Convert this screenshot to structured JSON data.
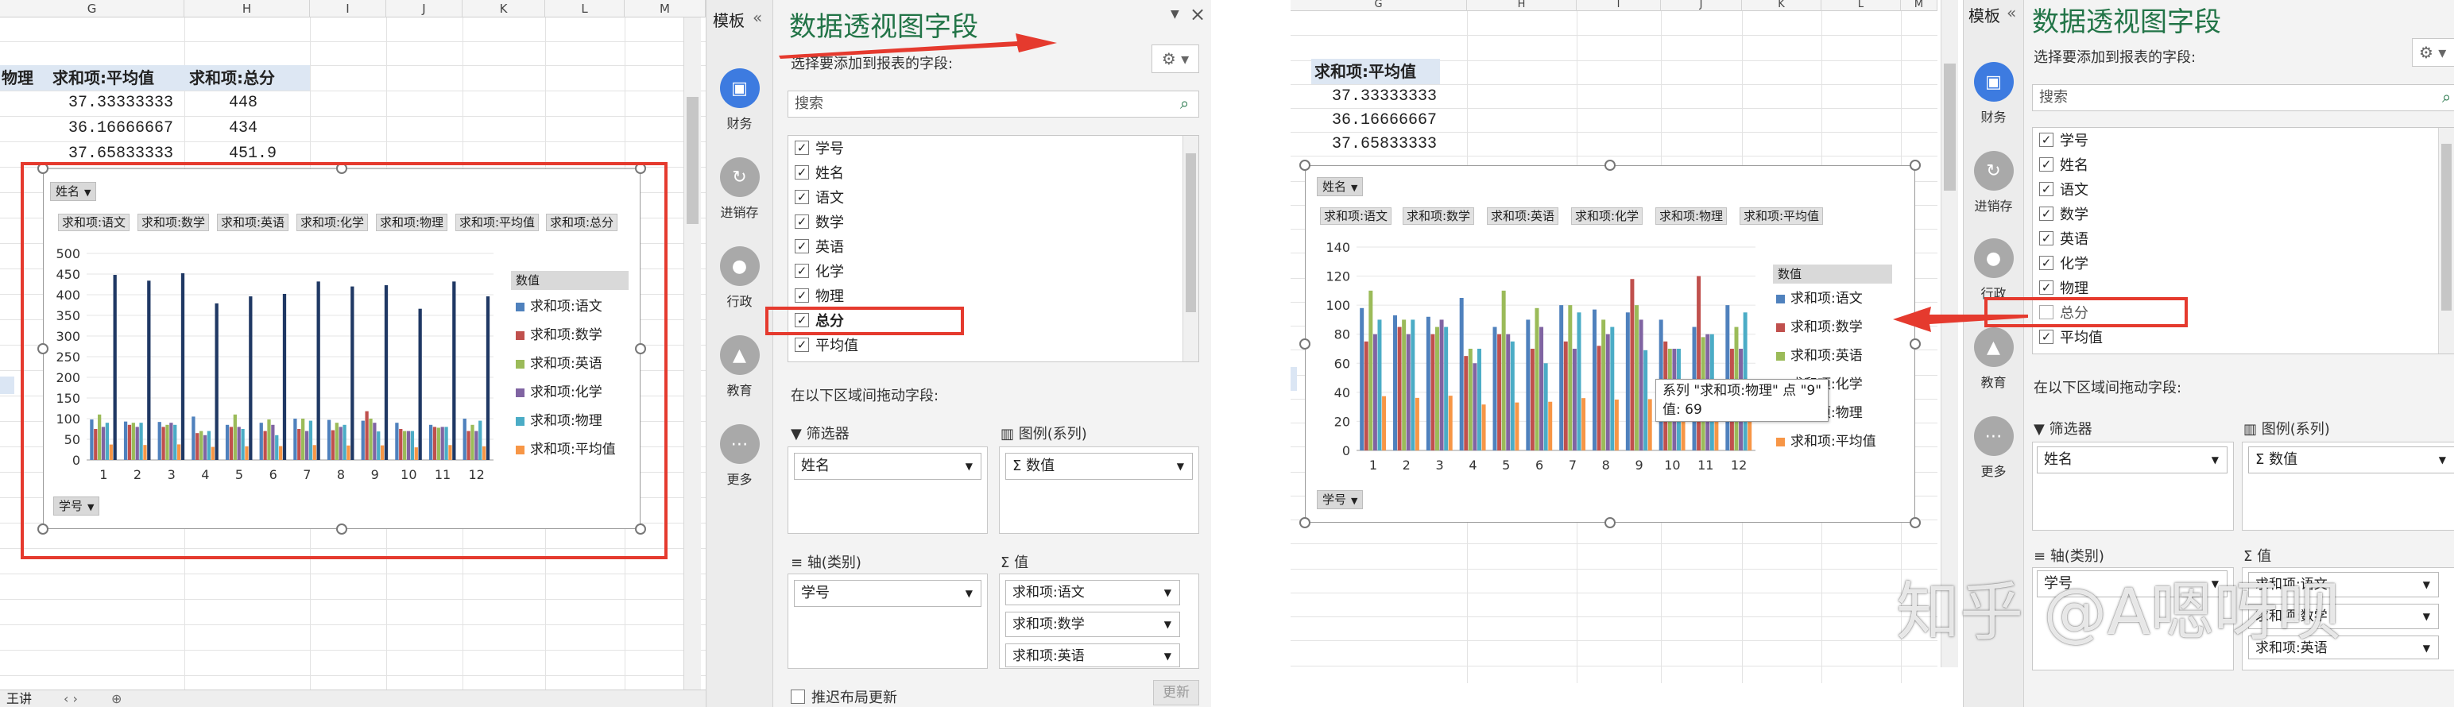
{
  "left": {
    "columns": [
      "G",
      "H",
      "I",
      "J",
      "K",
      "L",
      "M"
    ],
    "table": {
      "headers": [
        "物理",
        "求和项:平均值",
        "求和项:总分"
      ],
      "rows": [
        [
          "",
          "37.33333333",
          "448"
        ],
        [
          "",
          "36.16666667",
          "434"
        ],
        [
          "",
          "37.65833333",
          "451.9"
        ]
      ]
    },
    "chart": {
      "filter_button": "姓名",
      "axis_button": "学号",
      "value_buttons": [
        "求和项:语文",
        "求和项:数学",
        "求和项:英语",
        "求和项:化学",
        "求和项:物理",
        "求和项:平均值",
        "求和项:总分"
      ],
      "legend_title": "数值",
      "legend": [
        "求和项:语文",
        "求和项:数学",
        "求和项:英语",
        "求和项:化学",
        "求和项:物理",
        "求和项:平均值"
      ]
    },
    "ribbon": {
      "title": "模板",
      "items": [
        "财务",
        "进销存",
        "行政",
        "教育",
        "更多"
      ]
    },
    "pane": {
      "title": "数据透视图字段",
      "subtitle": "选择要添加到报表的字段:",
      "search_placeholder": "搜索",
      "fields": [
        {
          "label": "学号",
          "checked": true
        },
        {
          "label": "姓名",
          "checked": true
        },
        {
          "label": "语文",
          "checked": true
        },
        {
          "label": "数学",
          "checked": true
        },
        {
          "label": "英语",
          "checked": true
        },
        {
          "label": "化学",
          "checked": true
        },
        {
          "label": "物理",
          "checked": true
        },
        {
          "label": "总分",
          "checked": true
        },
        {
          "label": "平均值",
          "checked": true
        }
      ],
      "areas_label": "在以下区域间拖动字段:",
      "filter_label": "筛选器",
      "legend_label": "图例(系列)",
      "axis_label": "轴(类别)",
      "values_label": "值",
      "filter_value": "姓名",
      "legend_value": "Σ 数值",
      "axis_value": "学号",
      "values_list": [
        "求和项:语文",
        "求和项:数学",
        "求和项:英语"
      ],
      "defer_label": "推迟布局更新",
      "update_label": "更新"
    },
    "sheet_tab": "王讲"
  },
  "right": {
    "columns": [
      "G",
      "H",
      "I",
      "J",
      "K",
      "L",
      "M"
    ],
    "table": {
      "headers": [
        "求和项:平均值"
      ],
      "rows": [
        [
          "37.33333333"
        ],
        [
          "36.16666667"
        ],
        [
          "37.65833333"
        ]
      ]
    },
    "chart": {
      "filter_button": "姓名",
      "axis_button": "学号",
      "value_buttons": [
        "求和项:语文",
        "求和项:数学",
        "求和项:英语",
        "求和项:化学",
        "求和项:物理",
        "求和项:平均值"
      ],
      "legend_title": "数值",
      "legend": [
        "求和项:语文",
        "求和项:数学",
        "求和项:英语",
        "求和项:化学",
        "求和项:物理",
        "求和项:平均值"
      ],
      "tooltip_line1": "系列 \"求和项:物理\" 点 \"9\"",
      "tooltip_line2": "值: 69"
    },
    "ribbon": {
      "title": "模板",
      "items": [
        "财务",
        "进销存",
        "行政",
        "教育",
        "更多"
      ]
    },
    "pane": {
      "title": "数据透视图字段",
      "subtitle": "选择要添加到报表的字段:",
      "search_placeholder": "搜索",
      "fields": [
        {
          "label": "学号",
          "checked": true
        },
        {
          "label": "姓名",
          "checked": true
        },
        {
          "label": "语文",
          "checked": true
        },
        {
          "label": "数学",
          "checked": true
        },
        {
          "label": "英语",
          "checked": true
        },
        {
          "label": "化学",
          "checked": true
        },
        {
          "label": "物理",
          "checked": true
        },
        {
          "label": "总分",
          "checked": false
        },
        {
          "label": "平均值",
          "checked": true
        }
      ],
      "areas_label": "在以下区域间拖动字段:",
      "filter_label": "筛选器",
      "legend_label": "图例(系列)",
      "axis_label": "轴(类别)",
      "values_label": "值",
      "filter_value": "姓名",
      "legend_value": "Σ 数值",
      "axis_value": "学号",
      "values_list": [
        "求和项:语文",
        "求和项:数学",
        "求和项:英语"
      ]
    },
    "watermark": "知乎 @A嗯呀呗"
  },
  "colors": {
    "语文": "#4f81bd",
    "数学": "#c0504d",
    "英语": "#9bbb59",
    "化学": "#8064a2",
    "物理": "#4bacc6",
    "平均值": "#f79646",
    "总分": "#1f3864",
    "accent": "#227447",
    "highlight": "#e53a2e"
  },
  "chart_data": [
    {
      "type": "bar",
      "categories": [
        "1",
        "2",
        "3",
        "4",
        "5",
        "6",
        "7",
        "8",
        "9",
        "10",
        "11",
        "12"
      ],
      "ylim": [
        0,
        500
      ],
      "yticks": [
        0,
        50,
        100,
        150,
        200,
        250,
        300,
        350,
        400,
        450,
        500
      ],
      "series": [
        {
          "name": "求和项:语文",
          "values": [
            98,
            93,
            92,
            105,
            85,
            90,
            100,
            97,
            95,
            90,
            85,
            100
          ]
        },
        {
          "name": "求和项:数学",
          "values": [
            75,
            85,
            80,
            65,
            80,
            70,
            75,
            72,
            118,
            75,
            80,
            70
          ]
        },
        {
          "name": "求和项:英语",
          "values": [
            110,
            90,
            85,
            70,
            110,
            98,
            100,
            90,
            100,
            70,
            78,
            85
          ]
        },
        {
          "name": "求和项:化学",
          "values": [
            80,
            80,
            90,
            60,
            80,
            85,
            70,
            80,
            90,
            70,
            80,
            70
          ]
        },
        {
          "name": "求和项:物理",
          "values": [
            90,
            90,
            85,
            70,
            75,
            60,
            95,
            85,
            69,
            70,
            80,
            95
          ]
        },
        {
          "name": "求和项:平均值",
          "values": [
            37.33,
            36.17,
            37.66,
            31.6,
            33.0,
            33.5,
            36.0,
            35.0,
            35.3,
            30.5,
            36.0,
            33.0
          ]
        },
        {
          "name": "求和项:总分",
          "values": [
            448,
            434,
            451.9,
            379,
            396,
            402,
            432,
            420,
            423,
            366,
            432,
            396
          ]
        }
      ]
    },
    {
      "type": "bar",
      "categories": [
        "1",
        "2",
        "3",
        "4",
        "5",
        "6",
        "7",
        "8",
        "9",
        "10",
        "11",
        "12"
      ],
      "ylim": [
        0,
        140
      ],
      "yticks": [
        0,
        20,
        40,
        60,
        80,
        100,
        120,
        140
      ],
      "series": [
        {
          "name": "求和项:语文",
          "values": [
            98,
            93,
            92,
            105,
            85,
            90,
            100,
            97,
            95,
            90,
            85,
            100
          ]
        },
        {
          "name": "求和项:数学",
          "values": [
            75,
            85,
            80,
            65,
            80,
            70,
            75,
            72,
            118,
            75,
            120,
            70
          ]
        },
        {
          "name": "求和项:英语",
          "values": [
            110,
            90,
            85,
            70,
            110,
            98,
            100,
            90,
            100,
            70,
            78,
            85
          ]
        },
        {
          "name": "求和项:化学",
          "values": [
            80,
            80,
            90,
            60,
            80,
            85,
            70,
            80,
            90,
            70,
            80,
            70
          ]
        },
        {
          "name": "求和项:物理",
          "values": [
            90,
            90,
            85,
            70,
            75,
            60,
            95,
            85,
            69,
            70,
            80,
            95
          ]
        },
        {
          "name": "求和项:平均值",
          "values": [
            37.33,
            36.17,
            37.66,
            31.6,
            33.0,
            33.5,
            36.0,
            35.0,
            35.3,
            30.5,
            36.0,
            33.0
          ]
        }
      ]
    }
  ]
}
